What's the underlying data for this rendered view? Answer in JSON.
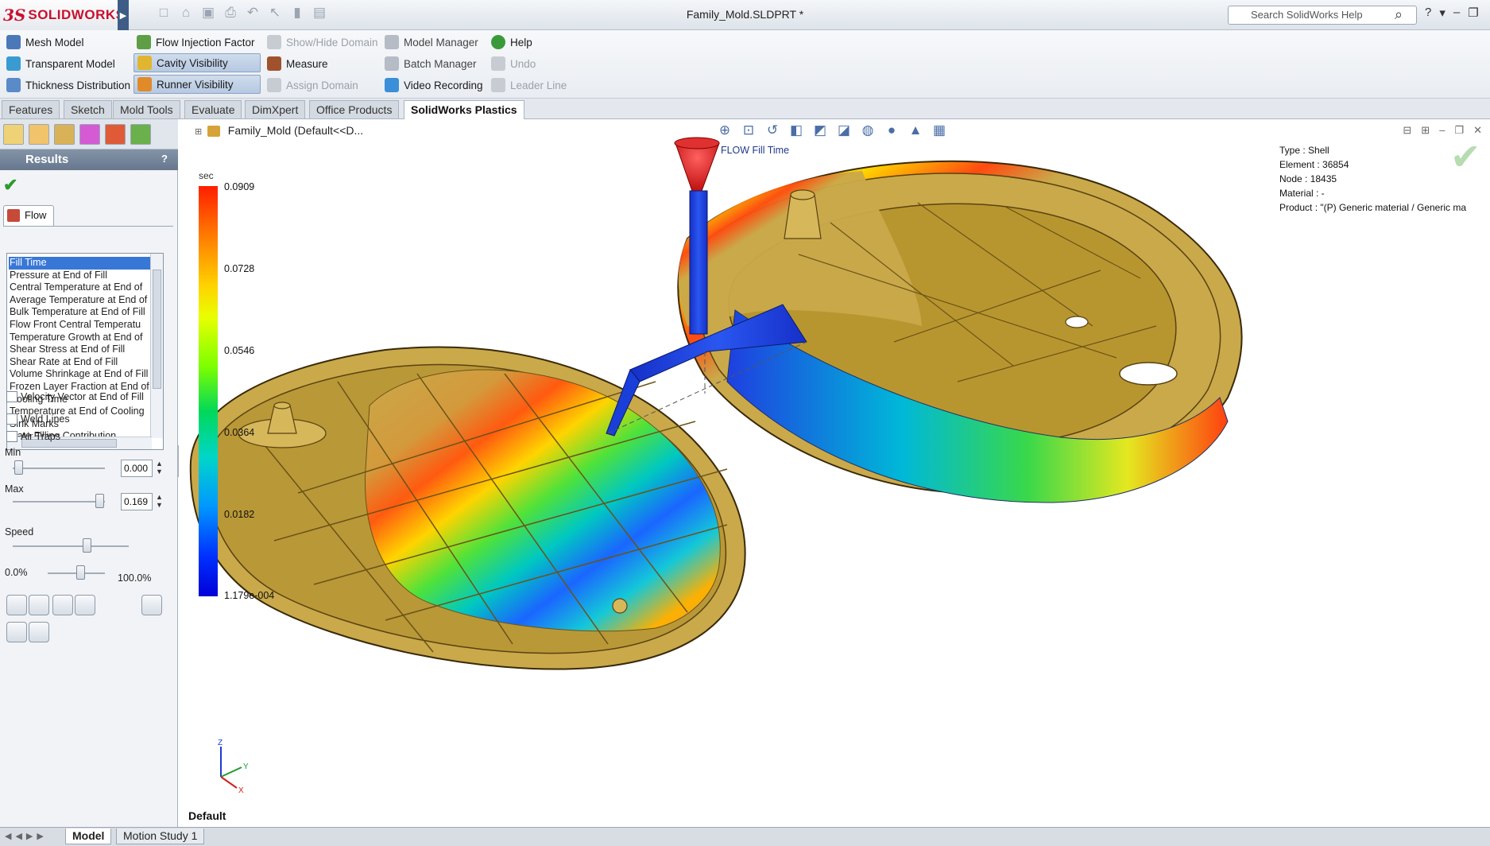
{
  "app": {
    "brand_mark": "3S",
    "brand_name": "SOLIDWORKS",
    "document_title": "Family_Mold.SLDPRT *",
    "help_search_placeholder": "Search SolidWorks Help"
  },
  "command_manager": {
    "col1": [
      "Mesh Model",
      "Transparent Model",
      "Thickness Distribution"
    ],
    "col2": [
      "Flow Injection Factor",
      "Cavity Visibility",
      "Runner Visibility"
    ],
    "col3": [
      "Show/Hide Domain",
      "Measure",
      "Assign Domain"
    ],
    "col4": [
      "Model Manager",
      "Batch Manager",
      "Video Recording"
    ],
    "col5": [
      "Help",
      "Undo",
      "Leader Line"
    ]
  },
  "tabs": [
    "Features",
    "Sketch",
    "Mold Tools",
    "Evaluate",
    "DimXpert",
    "Office Products",
    "SolidWorks Plastics"
  ],
  "active_tab": "SolidWorks Plastics",
  "panel": {
    "title": "Results",
    "help": "?",
    "flow_tab": "Flow",
    "result_types": [
      "Fill Time",
      "Pressure at End of Fill",
      "Central Temperature at End of",
      "Average Temperature at End of",
      "Bulk Temperature at End of Fill",
      "Flow Front Central Temperatu",
      "Temperature Growth at End of",
      "Shear Stress at End of Fill",
      "Shear Rate at End of Fill",
      "Volume Shrinkage at End of Fill",
      "Frozen Layer Fraction at End of",
      "Cooling Time",
      "Temperature at End of Cooling",
      "Sink Marks",
      "Gate Filling Contribution"
    ],
    "selected_index": 0,
    "velocity_vector": "Velocity Vector at End of Fill",
    "weld_lines": "Weld Lines",
    "air_traps": "Air Traps",
    "min_label": "Min",
    "min_value": "0.000",
    "max_label": "Max",
    "max_value": "0.169",
    "speed_label": "Speed",
    "range_start": "0.0%",
    "range_end": "100.0%"
  },
  "viewport": {
    "tree_root": "Family_Mold  (Default<<D...",
    "plot_title": "FLOW Fill Time",
    "info": {
      "type": "Type : Shell",
      "element": "Element : 36854",
      "node": "Node : 18435",
      "material": "Material : -",
      "product": "Product :   \"(P)  Generic material / Generic ma"
    },
    "scale_unit": "sec",
    "scale_values": [
      "0.0909",
      "0.0728",
      "0.0546",
      "0.0364",
      "0.0182",
      "1.179e-004"
    ],
    "view_name": "Default",
    "triad": {
      "z": "Z",
      "y": "Y",
      "x": "X"
    }
  },
  "bottom_tabs": [
    "Model",
    "Motion Study 1"
  ],
  "colors": {
    "brand_red": "#c8102e",
    "part_gold": "#c9a94a",
    "runner_blue": "#1a3fd8",
    "sprue_red": "#e02020"
  },
  "icons": [
    "new-icon",
    "open-icon",
    "save-icon",
    "print-icon",
    "undo-icon",
    "select-icon",
    "rebuild-icon",
    "options-icon",
    "search-icon",
    "help-icon",
    "zoom-fit-icon",
    "zoom-area-icon",
    "previous-view-icon",
    "section-view-icon",
    "view-orientation-icon",
    "display-style-icon",
    "hide-show-icon",
    "appearance-icon",
    "scene-icon",
    "view-settings-icon"
  ]
}
